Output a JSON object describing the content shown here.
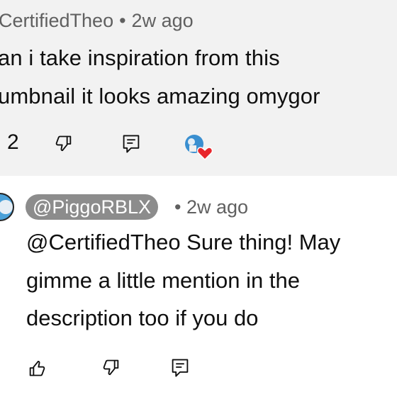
{
  "top_comment": {
    "author": "CertifiedTheo",
    "separator": "•",
    "time": "2w ago",
    "text_lines": [
      "an i take inspiration from this",
      "umbnail it looks amazing omygor"
    ],
    "like_count": "2",
    "icons": [
      "thumbs-down-icon",
      "reply-icon",
      "creator-heart-icon"
    ]
  },
  "reply": {
    "handle": "@PiggoRBLX",
    "separator": "•",
    "time": "2w ago",
    "text_lines": [
      "@CertifiedTheo  Sure thing! May",
      "gimme a little mention in the",
      "description too if you do"
    ],
    "icons": [
      "thumbs-up-icon",
      "thumbs-down-icon",
      "reply-icon"
    ]
  },
  "colors": {
    "top_background": "#f2f2f2",
    "badge_background": "#8c8c8c",
    "meta_text": "#606060",
    "heart": "#e8262c"
  }
}
